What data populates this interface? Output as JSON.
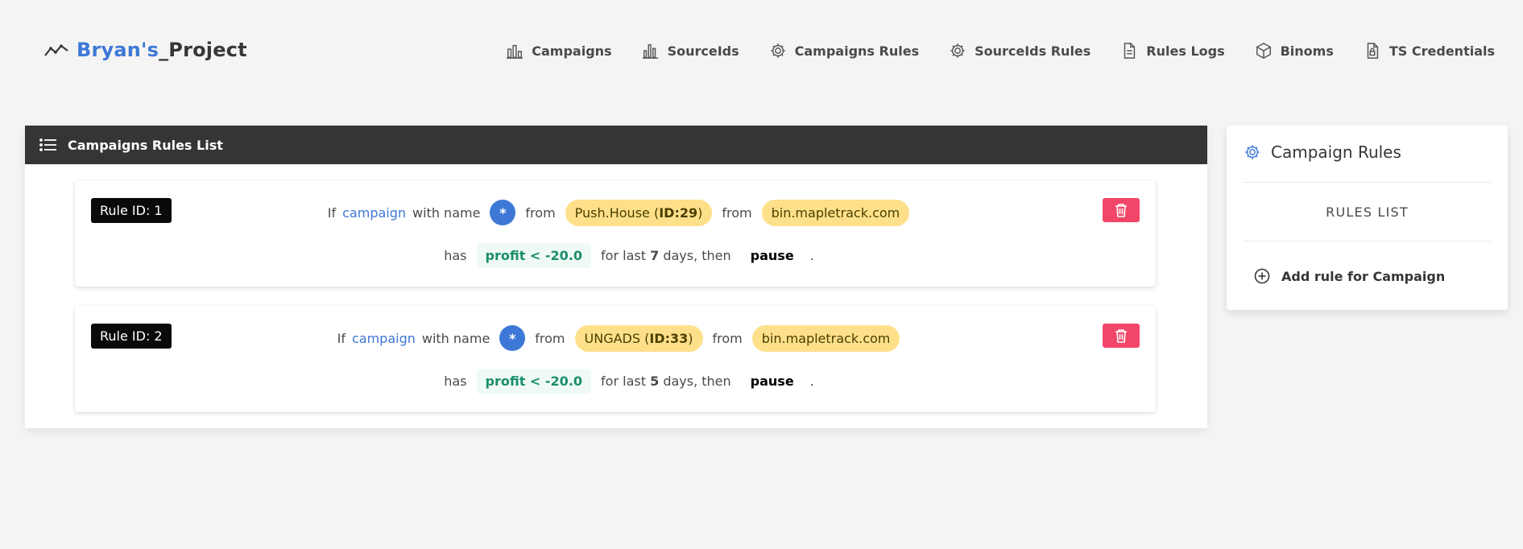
{
  "brand": {
    "part1": "Bryan's",
    "part2": "_Project"
  },
  "nav": {
    "campaigns": "Campaigns",
    "sourceids": "SourceIds",
    "campaigns_rules": "Campaigns Rules",
    "sourceids_rules": "SourceIds Rules",
    "rules_logs": "Rules Logs",
    "binoms": "Binoms",
    "ts_credentials": "TS Credentials"
  },
  "main": {
    "title": "Campaigns Rules List",
    "rules": [
      {
        "id_label": "Rule ID: 1",
        "if": "If",
        "entity": "campaign",
        "with_name": "with name",
        "name_value": "*",
        "from1": "from",
        "source_name": "Push.House (",
        "source_id": "ID:29",
        "source_close": ")",
        "from2": "from",
        "tracker": "bin.mapletrack.com",
        "has": "has",
        "condition": "profit < -20.0",
        "for_last": "for last",
        "days": "7",
        "days_then": "days, then",
        "action": "pause",
        "dot": "."
      },
      {
        "id_label": "Rule ID: 2",
        "if": "If",
        "entity": "campaign",
        "with_name": "with name",
        "name_value": "*",
        "from1": "from",
        "source_name": "UNGADS (",
        "source_id": "ID:33",
        "source_close": ")",
        "from2": "from",
        "tracker": "bin.mapletrack.com",
        "has": "has",
        "condition": "profit < -20.0",
        "for_last": "for last",
        "days": "5",
        "days_then": "days, then",
        "action": "pause",
        "dot": "."
      }
    ]
  },
  "side": {
    "title": "Campaign Rules",
    "list_label": "RULES LIST",
    "add_label": "Add rule for Campaign"
  },
  "colors": {
    "accent": "#3e78d6",
    "header_bg": "#353535",
    "tag_yellow": "#ffe08a",
    "danger": "#f14668",
    "teal": "#1b8d6d"
  },
  "icons": {
    "brand": "trend-line-icon",
    "campaigns": "bar-chart-icon",
    "sourceids": "bar-chart-icon",
    "campaigns_rules": "gear-icon",
    "sourceids_rules": "gear-icon",
    "rules_logs": "document-icon",
    "binoms": "cube-icon",
    "ts_credentials": "lock-file-icon",
    "list": "list-icon",
    "delete": "trash-icon",
    "add": "plus-circle-icon"
  }
}
